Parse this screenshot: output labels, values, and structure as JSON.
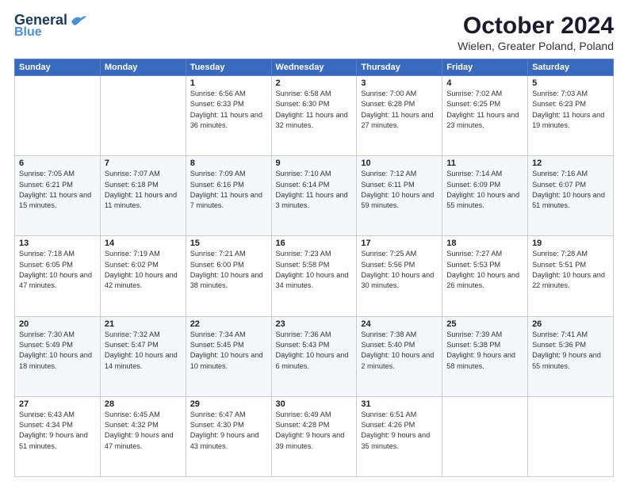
{
  "header": {
    "logo_line1": "General",
    "logo_line2": "Blue",
    "title": "October 2024",
    "subtitle": "Wielen, Greater Poland, Poland"
  },
  "days_of_week": [
    "Sunday",
    "Monday",
    "Tuesday",
    "Wednesday",
    "Thursday",
    "Friday",
    "Saturday"
  ],
  "weeks": [
    [
      {
        "day": "",
        "info": ""
      },
      {
        "day": "",
        "info": ""
      },
      {
        "day": "1",
        "info": "Sunrise: 6:56 AM\nSunset: 6:33 PM\nDaylight: 11 hours and 36 minutes."
      },
      {
        "day": "2",
        "info": "Sunrise: 6:58 AM\nSunset: 6:30 PM\nDaylight: 11 hours and 32 minutes."
      },
      {
        "day": "3",
        "info": "Sunrise: 7:00 AM\nSunset: 6:28 PM\nDaylight: 11 hours and 27 minutes."
      },
      {
        "day": "4",
        "info": "Sunrise: 7:02 AM\nSunset: 6:25 PM\nDaylight: 11 hours and 23 minutes."
      },
      {
        "day": "5",
        "info": "Sunrise: 7:03 AM\nSunset: 6:23 PM\nDaylight: 11 hours and 19 minutes."
      }
    ],
    [
      {
        "day": "6",
        "info": "Sunrise: 7:05 AM\nSunset: 6:21 PM\nDaylight: 11 hours and 15 minutes."
      },
      {
        "day": "7",
        "info": "Sunrise: 7:07 AM\nSunset: 6:18 PM\nDaylight: 11 hours and 11 minutes."
      },
      {
        "day": "8",
        "info": "Sunrise: 7:09 AM\nSunset: 6:16 PM\nDaylight: 11 hours and 7 minutes."
      },
      {
        "day": "9",
        "info": "Sunrise: 7:10 AM\nSunset: 6:14 PM\nDaylight: 11 hours and 3 minutes."
      },
      {
        "day": "10",
        "info": "Sunrise: 7:12 AM\nSunset: 6:11 PM\nDaylight: 10 hours and 59 minutes."
      },
      {
        "day": "11",
        "info": "Sunrise: 7:14 AM\nSunset: 6:09 PM\nDaylight: 10 hours and 55 minutes."
      },
      {
        "day": "12",
        "info": "Sunrise: 7:16 AM\nSunset: 6:07 PM\nDaylight: 10 hours and 51 minutes."
      }
    ],
    [
      {
        "day": "13",
        "info": "Sunrise: 7:18 AM\nSunset: 6:05 PM\nDaylight: 10 hours and 47 minutes."
      },
      {
        "day": "14",
        "info": "Sunrise: 7:19 AM\nSunset: 6:02 PM\nDaylight: 10 hours and 42 minutes."
      },
      {
        "day": "15",
        "info": "Sunrise: 7:21 AM\nSunset: 6:00 PM\nDaylight: 10 hours and 38 minutes."
      },
      {
        "day": "16",
        "info": "Sunrise: 7:23 AM\nSunset: 5:58 PM\nDaylight: 10 hours and 34 minutes."
      },
      {
        "day": "17",
        "info": "Sunrise: 7:25 AM\nSunset: 5:56 PM\nDaylight: 10 hours and 30 minutes."
      },
      {
        "day": "18",
        "info": "Sunrise: 7:27 AM\nSunset: 5:53 PM\nDaylight: 10 hours and 26 minutes."
      },
      {
        "day": "19",
        "info": "Sunrise: 7:28 AM\nSunset: 5:51 PM\nDaylight: 10 hours and 22 minutes."
      }
    ],
    [
      {
        "day": "20",
        "info": "Sunrise: 7:30 AM\nSunset: 5:49 PM\nDaylight: 10 hours and 18 minutes."
      },
      {
        "day": "21",
        "info": "Sunrise: 7:32 AM\nSunset: 5:47 PM\nDaylight: 10 hours and 14 minutes."
      },
      {
        "day": "22",
        "info": "Sunrise: 7:34 AM\nSunset: 5:45 PM\nDaylight: 10 hours and 10 minutes."
      },
      {
        "day": "23",
        "info": "Sunrise: 7:36 AM\nSunset: 5:43 PM\nDaylight: 10 hours and 6 minutes."
      },
      {
        "day": "24",
        "info": "Sunrise: 7:38 AM\nSunset: 5:40 PM\nDaylight: 10 hours and 2 minutes."
      },
      {
        "day": "25",
        "info": "Sunrise: 7:39 AM\nSunset: 5:38 PM\nDaylight: 9 hours and 58 minutes."
      },
      {
        "day": "26",
        "info": "Sunrise: 7:41 AM\nSunset: 5:36 PM\nDaylight: 9 hours and 55 minutes."
      }
    ],
    [
      {
        "day": "27",
        "info": "Sunrise: 6:43 AM\nSunset: 4:34 PM\nDaylight: 9 hours and 51 minutes."
      },
      {
        "day": "28",
        "info": "Sunrise: 6:45 AM\nSunset: 4:32 PM\nDaylight: 9 hours and 47 minutes."
      },
      {
        "day": "29",
        "info": "Sunrise: 6:47 AM\nSunset: 4:30 PM\nDaylight: 9 hours and 43 minutes."
      },
      {
        "day": "30",
        "info": "Sunrise: 6:49 AM\nSunset: 4:28 PM\nDaylight: 9 hours and 39 minutes."
      },
      {
        "day": "31",
        "info": "Sunrise: 6:51 AM\nSunset: 4:26 PM\nDaylight: 9 hours and 35 minutes."
      },
      {
        "day": "",
        "info": ""
      },
      {
        "day": "",
        "info": ""
      }
    ]
  ]
}
